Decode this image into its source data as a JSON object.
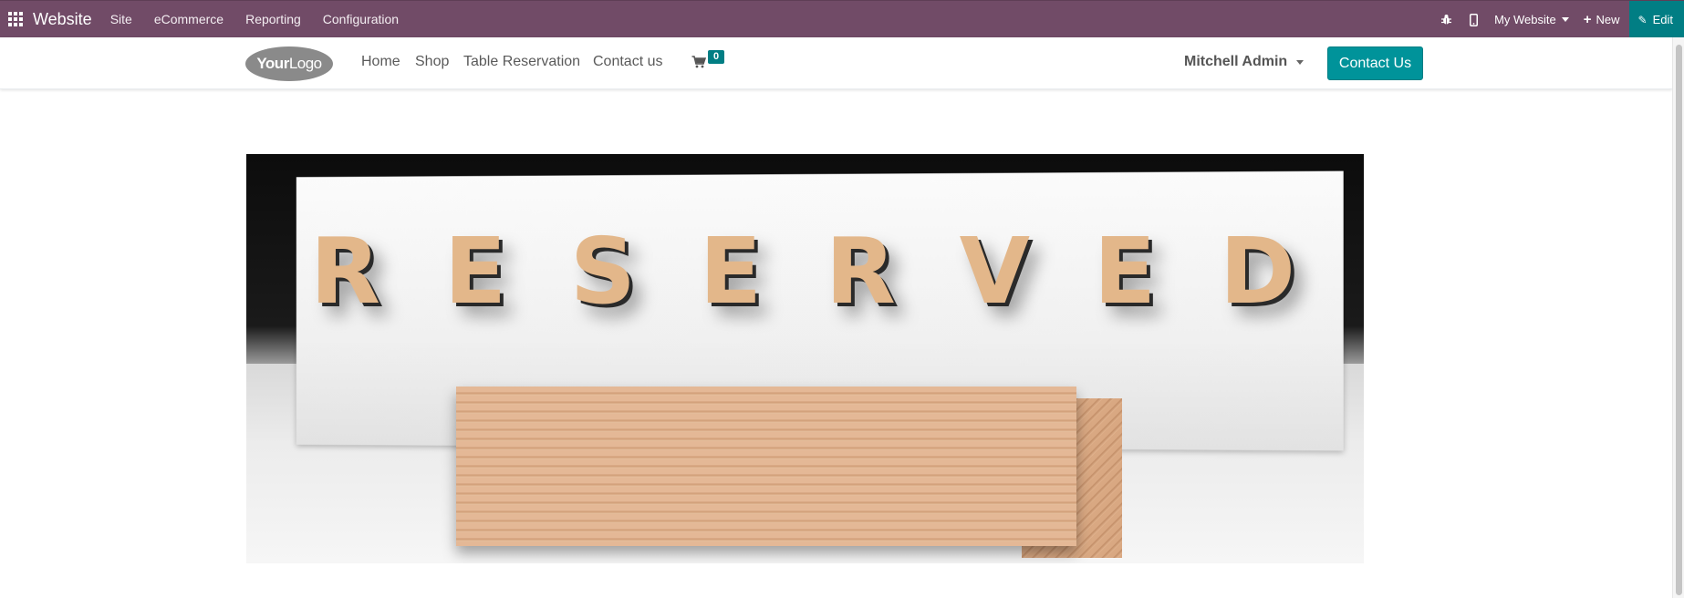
{
  "topbar": {
    "brand": "Website",
    "menu": [
      "Site",
      "eCommerce",
      "Reporting",
      "Configuration"
    ],
    "my_website": "My Website",
    "new_label": "New",
    "edit_label": "Edit",
    "icons": [
      "apps-icon",
      "bug-icon",
      "mobile-icon",
      "plus-icon",
      "pencil-icon"
    ]
  },
  "site_nav": {
    "logo_your": "Your",
    "logo_logo": "Logo",
    "links": [
      "Home",
      "Shop",
      "Table Reservation",
      "Contact us"
    ],
    "cart_count": "0",
    "user": "Mitchell Admin",
    "contact_button": "Contact Us"
  },
  "hero": {
    "sign_text": [
      "R",
      "E",
      "S",
      "E",
      "R",
      "V",
      "E",
      "D"
    ]
  },
  "colors": {
    "topbar_bg": "#714B67",
    "accent": "#017E84"
  }
}
